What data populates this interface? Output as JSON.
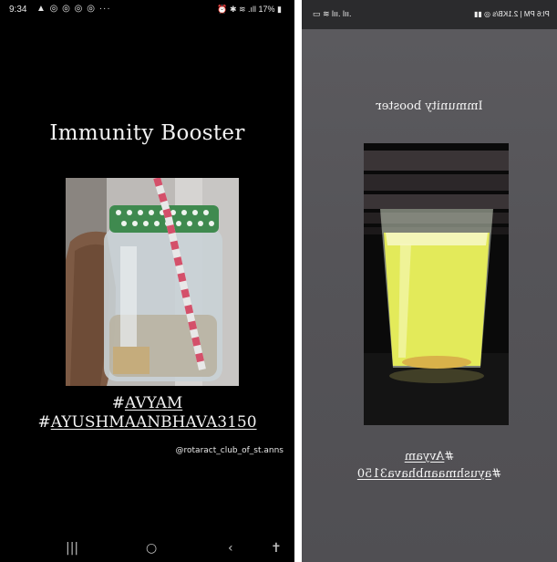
{
  "left_screen": {
    "status_bar": {
      "time": "9:34",
      "left_icons": "▲ ◎ ◎ ◎ ◎ ···",
      "right_text": "⏰ ✱ ≋ .ıll 17% ▮"
    },
    "story": {
      "title": "Immunity Booster",
      "hashtag_1": "AVYAM",
      "hashtag_2": "AYUSHMAANBHAVA3150",
      "handle": "@rotaract_club_of_st.anns"
    },
    "nav_bar": {
      "recent": "|||",
      "home": "○",
      "back": "‹",
      "accessibility": "✝"
    }
  },
  "right_screen": {
    "status_bar": {
      "left_cluster": "▭ ≋ lıı. lıı.",
      "right_text": "Pl:6 PM | 2.1KB/s ◎ ▮▮"
    },
    "story": {
      "title": "Immunity booster",
      "hashtag_1": "Avyam",
      "hashtag_2": "ayushmaanbhava3150"
    }
  }
}
